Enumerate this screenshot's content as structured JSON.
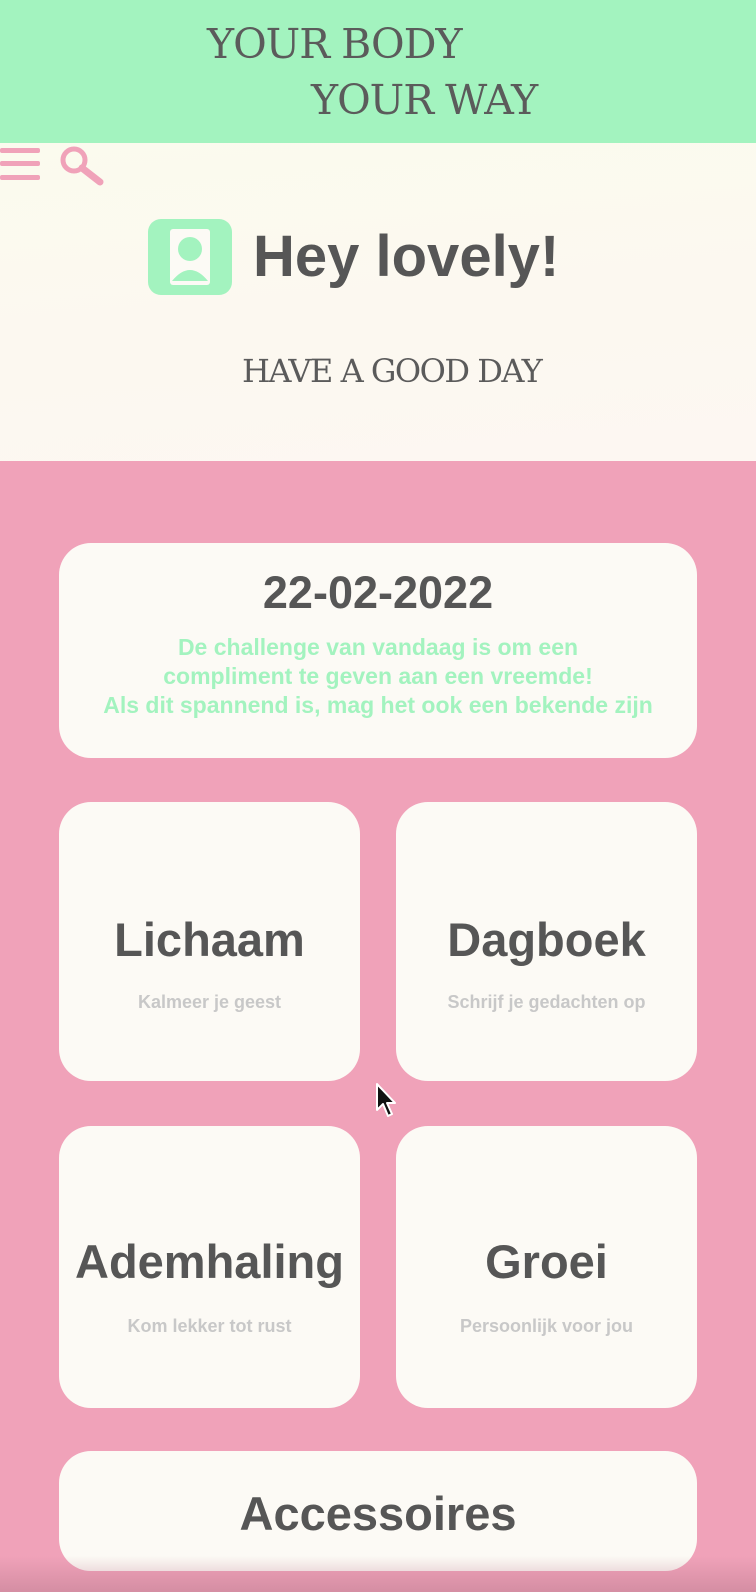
{
  "header": {
    "brand_line_1": "YOUR BODY",
    "brand_line_2": "YOUR WAY"
  },
  "toolbar": {
    "menu_icon": "hamburger-icon",
    "search_icon": "magnifier-icon"
  },
  "hero": {
    "avatar_icon": "user-icon",
    "greeting": "Hey lovely!",
    "tagline": "HAVE A GOOD DAY"
  },
  "challenge": {
    "date": "22-02-2022",
    "line_1": "De challenge van vandaag is om een",
    "line_2": "compliment te geven aan een vreemde!",
    "line_3": "Als dit spannend is, mag het ook een bekende zijn"
  },
  "tiles": [
    {
      "title": "Lichaam",
      "subtitle": "Kalmeer je geest"
    },
    {
      "title": "Dagboek",
      "subtitle": "Schrijf je gedachten op"
    },
    {
      "title": "Ademhaling",
      "subtitle": "Kom lekker tot rust"
    },
    {
      "title": "Groei",
      "subtitle": "Persoonlijk voor jou"
    }
  ],
  "accessoires": {
    "title": "Accessoires"
  },
  "colors": {
    "mint": "#a3f3bf",
    "pink": "#f0a2b9",
    "cream": "#fcfaf5",
    "text_dark": "#565656",
    "text_muted": "#c8c8c8"
  }
}
